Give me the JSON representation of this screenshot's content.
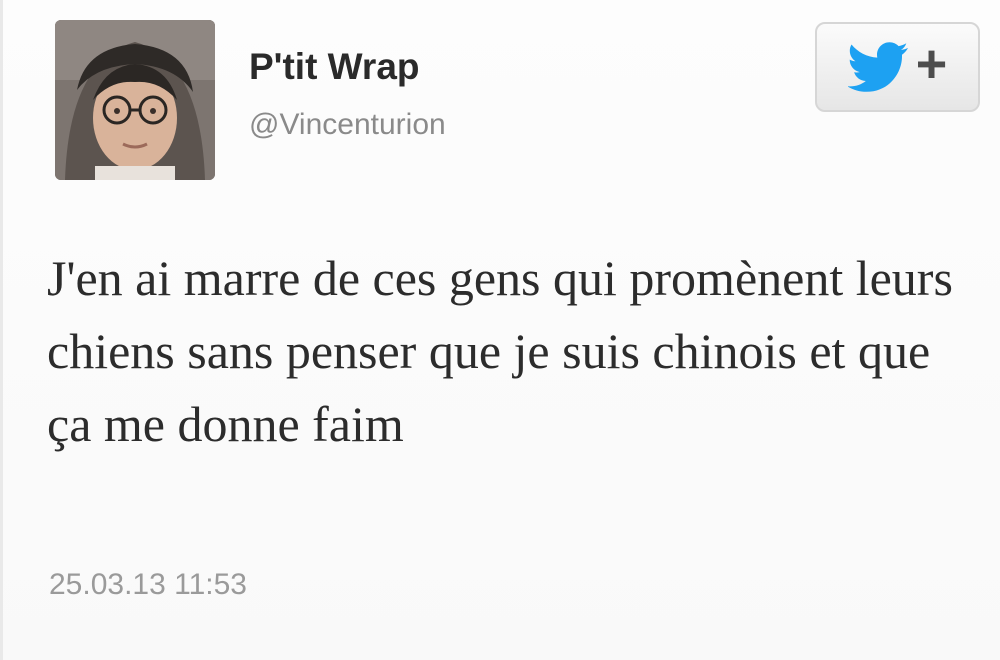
{
  "user": {
    "display_name": "P'tit Wrap",
    "handle": "@Vincenturion",
    "avatar": "user-photo"
  },
  "follow_button": {
    "icon": "twitter-bird-icon",
    "plus_label": "+",
    "accent_color": "#1da1f2"
  },
  "tweet": {
    "text": "J'en ai marre de ces gens qui promènent leurs chiens sans penser que je suis chinois et que ça me donne faim",
    "timestamp": "25.03.13 11:53"
  }
}
